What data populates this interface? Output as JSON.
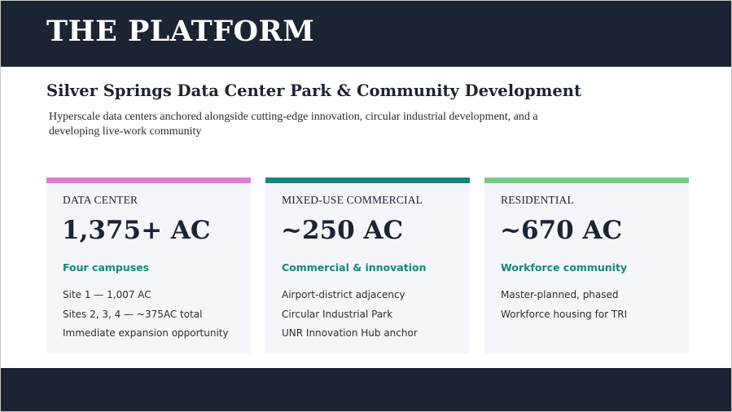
{
  "header": {
    "title": "THE PLATFORM"
  },
  "intro": {
    "subtitle": "Silver Springs Data Center Park & Community Development",
    "description": "Hyperscale data centers anchored alongside cutting-edge innovation, circular industrial development, and a developing live-work community"
  },
  "cards": [
    {
      "label": "DATA CENTER",
      "value": "1,375+ AC",
      "highlight": "Four campuses",
      "items": [
        "Site 1 — 1,007 AC",
        "Sites 2, 3, 4 — ~375AC total",
        "Immediate expansion opportunity"
      ],
      "accent_color": "#dc7fd2"
    },
    {
      "label": "MIXED-USE COMMERCIAL",
      "value": "~250 AC",
      "highlight": "Commercial & innovation",
      "items": [
        "Airport-district adjacency",
        "Circular Industrial Park",
        "UNR Innovation Hub anchor"
      ],
      "accent_color": "#16877c"
    },
    {
      "label": "RESIDENTIAL",
      "value": "~670 AC",
      "highlight": "Workforce community",
      "items": [
        "Master-planned, phased",
        "Workforce housing for TRI"
      ],
      "accent_color": "#7cc88a"
    }
  ],
  "colors": {
    "navy": "#1b2433",
    "teal": "#16877c",
    "card_background": "#f4f6f9"
  }
}
